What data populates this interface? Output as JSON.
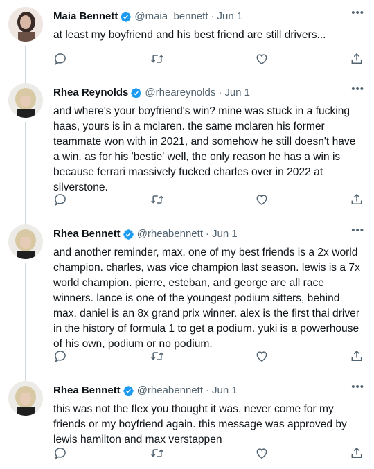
{
  "tweets": [
    {
      "name": "Maia Bennett",
      "handle": "@maia_bennett",
      "separator": "·",
      "date": "Jun 1",
      "text": "at least my boyfriend and his best friend are still drivers...",
      "avatar_color": "#6b5046"
    },
    {
      "name": "Rhea Reynolds",
      "handle": "@rheareynolds",
      "separator": "·",
      "date": "Jun 1",
      "text": "and where's your boyfriend's win? mine was stuck in a fucking haas, yours is in a mclaren. the same mclaren his former teammate won with in 2021, and somehow he still doesn't have a win. as for his 'bestie' well, the only reason he has a win is because ferrari massively fucked charles over in 2022 at silverstone.",
      "avatar_color": "#d8c8a4"
    },
    {
      "name": "Rhea Bennett",
      "handle": "@rheabennett",
      "separator": "·",
      "date": "Jun 1",
      "text": "and another reminder, max, one of my best friends is a 2x world champion. charles, was vice champion last season. lewis is a 7x world champion. pierre, esteban, and george are all race winners. lance is one of the youngest podium sitters, behind max. daniel is an 8x grand prix winner. alex is the first thai driver in the history of formula 1 to get a podium. yuki is a powerhouse of his own, podium or no podium.",
      "avatar_color": "#d8c8a4"
    },
    {
      "name": "Rhea Bennett",
      "handle": "@rheabennett",
      "separator": "·",
      "date": "Jun 1",
      "text": "this was not the flex you thought it was. never come for my friends or my boyfriend again. this message was approved by lewis hamilton and max verstappen",
      "avatar_color": "#d8c8a4"
    }
  ],
  "icons": [
    "reply-icon",
    "retweet-icon",
    "like-icon",
    "share-icon",
    "verified-icon",
    "more-icon"
  ],
  "colors": {
    "verified": "#1d9bf0",
    "muted": "#536471",
    "thread_line": "#cfd9de",
    "text": "#0f1419"
  }
}
